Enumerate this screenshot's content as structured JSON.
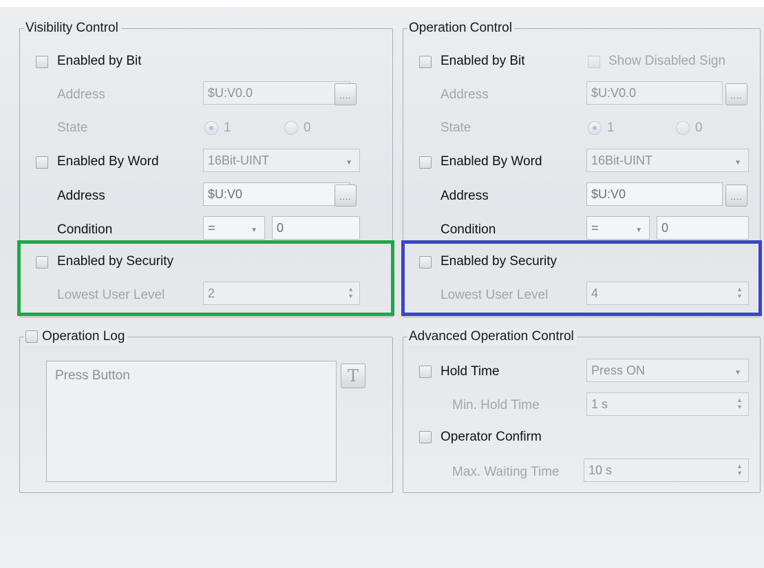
{
  "visibility": {
    "title": "Visibility Control",
    "enabled_by_bit": "Enabled by Bit",
    "address_label": "Address",
    "address_value": "$U:V0.0",
    "dots": "....",
    "state_label": "State",
    "state_opt1": "1",
    "state_opt0": "0",
    "enabled_by_word": "Enabled By Word",
    "word_type": "16Bit-UINT",
    "word_address_label": "Address",
    "word_address_value": "$U:V0",
    "condition_label": "Condition",
    "condition_op": "=",
    "condition_value": "0",
    "enabled_by_security": "Enabled by Security",
    "lowest_user_level_label": "Lowest User Level",
    "lowest_user_level": "2"
  },
  "operation": {
    "title": "Operation Control",
    "enabled_by_bit": "Enabled by Bit",
    "show_disabled_sign": "Show Disabled Sign",
    "address_label": "Address",
    "address_value": "$U:V0.0",
    "dots": "....",
    "state_label": "State",
    "state_opt1": "1",
    "state_opt0": "0",
    "enabled_by_word": "Enabled By Word",
    "word_type": "16Bit-UINT",
    "word_address_label": "Address",
    "word_address_value": "$U:V0",
    "condition_label": "Condition",
    "condition_op": "=",
    "condition_value": "0",
    "enabled_by_security": "Enabled by Security",
    "lowest_user_level_label": "Lowest User Level",
    "lowest_user_level": "4"
  },
  "operation_log": {
    "title": "Operation Log",
    "text": "Press Button",
    "text_button": "T"
  },
  "advanced": {
    "title": "Advanced Operation Control",
    "hold_time": "Hold Time",
    "hold_mode": "Press ON",
    "min_hold_label": "Min. Hold Time",
    "min_hold_value": "1 s",
    "operator_confirm": "Operator Confirm",
    "max_wait_label": "Max. Waiting Time",
    "max_wait_value": "10 s"
  },
  "colors": {
    "highlight_left": "#1fa84a",
    "highlight_right": "#3b45c4"
  }
}
